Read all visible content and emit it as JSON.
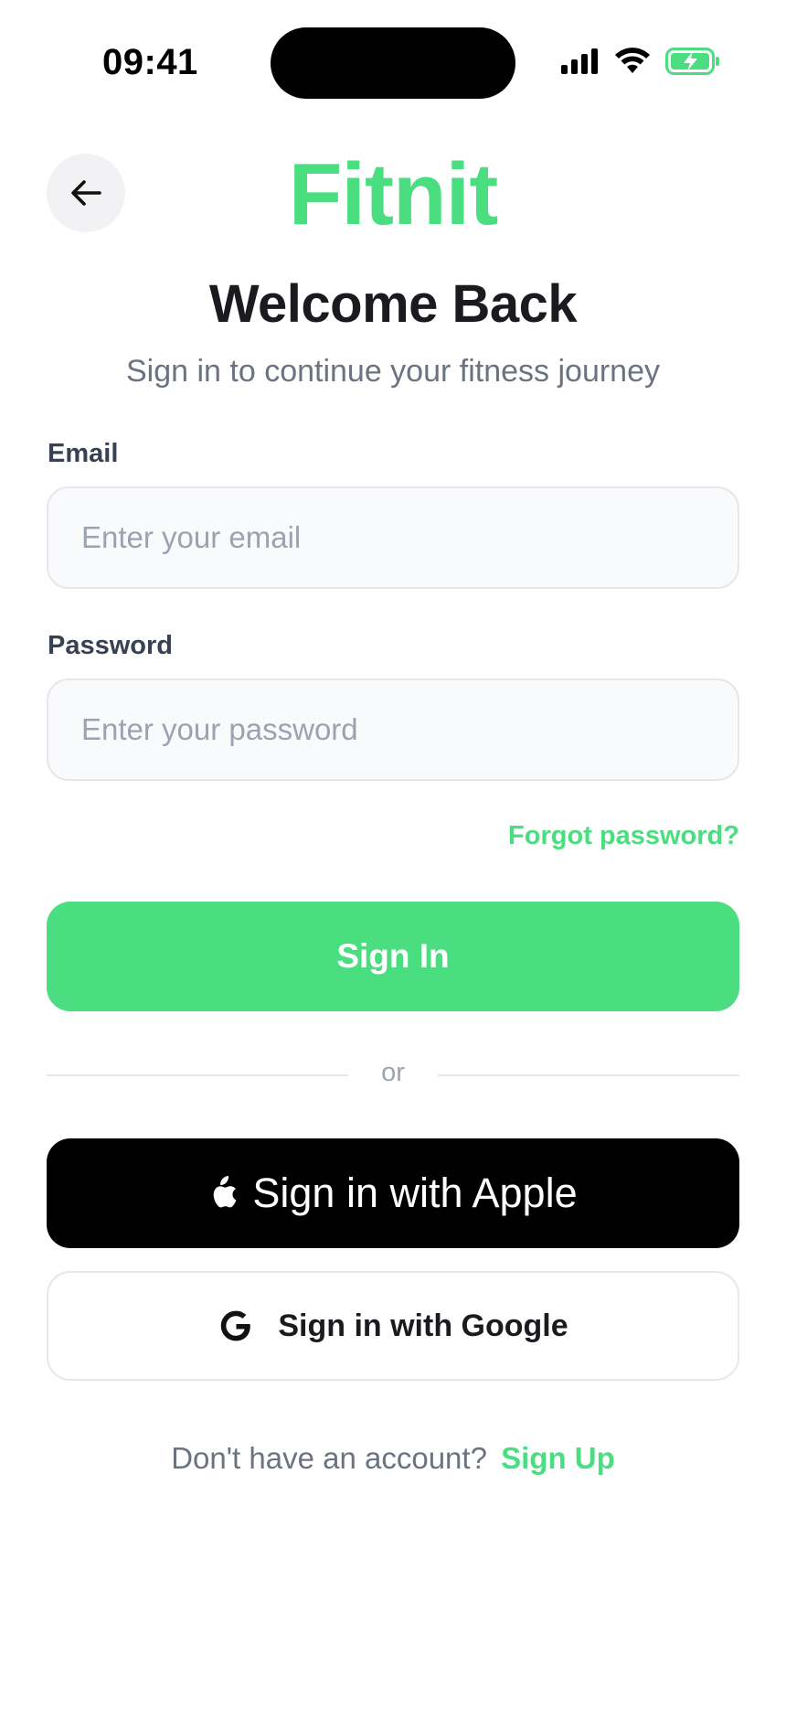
{
  "theme": {
    "accent": "#4ade80",
    "text_primary": "#1b1b1f",
    "text_secondary": "#6b7280"
  },
  "status_bar": {
    "time": "09:41",
    "icons": [
      "cellular-signal-icon",
      "wifi-icon",
      "battery-charging-icon"
    ]
  },
  "header": {
    "back_icon": "arrow-left-icon",
    "logo": "Fitnit"
  },
  "welcome": {
    "title": "Welcome Back",
    "subtitle": "Sign in to continue your fitness journey"
  },
  "form": {
    "email": {
      "label": "Email",
      "value": "",
      "placeholder": "Enter your email"
    },
    "password": {
      "label": "Password",
      "value": "",
      "placeholder": "Enter your password"
    },
    "forgot_label": "Forgot password?",
    "submit_label": "Sign In"
  },
  "divider": {
    "text": "or"
  },
  "social": {
    "apple_icon": "apple-logo-icon",
    "apple_label": "Sign in with Apple",
    "google_icon": "google-logo-icon",
    "google_label": "Sign in with Google"
  },
  "footer": {
    "prompt": "Don't have an account?",
    "signup_label": "Sign Up"
  }
}
